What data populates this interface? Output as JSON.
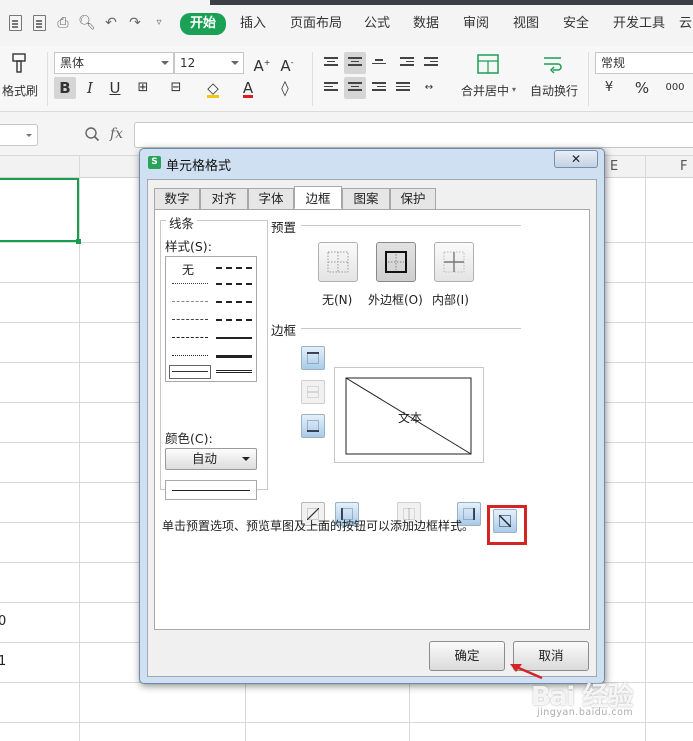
{
  "menubar": {
    "tabs": [
      "开始",
      "插入",
      "页面布局",
      "公式",
      "数据",
      "审阅",
      "视图",
      "安全",
      "开发工具",
      "云"
    ]
  },
  "ribbon": {
    "format_painter": "格式刷",
    "font_name": "黑体",
    "font_size": "12",
    "merge_center": "合并居中",
    "wrap_text": "自动换行",
    "number_format": "常规",
    "percent": "%",
    "thousands": "000"
  },
  "formula_bar": {
    "fx": "fx"
  },
  "sheet": {
    "columns": [
      "E",
      "F"
    ],
    "cells": [
      "0",
      "1"
    ]
  },
  "dialog": {
    "title": "单元格格式",
    "close_label": "✕",
    "tabs": [
      "数字",
      "对齐",
      "字体",
      "边框",
      "图案",
      "保护"
    ],
    "active_tab": "边框",
    "line_group": {
      "title": "线条",
      "style_label": "样式(S):",
      "none_label": "无",
      "color_label": "颜色(C):",
      "color_value": "自动"
    },
    "presets": {
      "title": "预置",
      "none": "无(N)",
      "outline": "外边框(O)",
      "inside": "内部(I)"
    },
    "border": {
      "title": "边框",
      "preview_text": "文本"
    },
    "hint": "单击预置选项、预览草图及上面的按钮可以添加边框样式。",
    "ok": "确定",
    "cancel": "取消"
  },
  "watermark": {
    "brand": "Bai 经验",
    "url": "jingyan.baidu.com"
  },
  "colors": {
    "accent_green": "#1aa155",
    "highlight_red": "#d42424"
  }
}
